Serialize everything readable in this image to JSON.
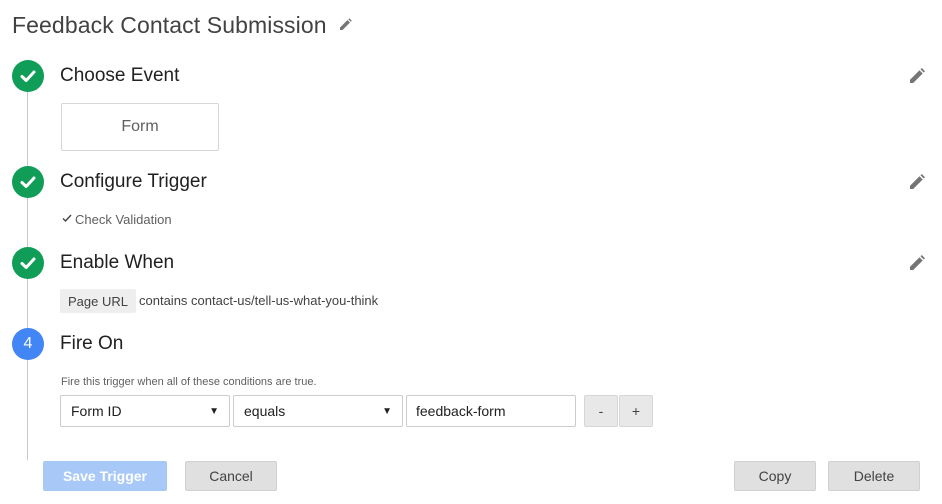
{
  "header": {
    "title": "Feedback Contact Submission",
    "title_edit_icon": "pencil-icon"
  },
  "steps": [
    {
      "title": "Choose Event",
      "status": "done",
      "status_icon": "check-icon",
      "edit_icon": "pencil-icon"
    },
    {
      "title": "Configure Trigger",
      "status": "done",
      "status_icon": "check-icon",
      "edit_icon": "pencil-icon"
    },
    {
      "title": "Enable When",
      "status": "done",
      "status_icon": "check-icon",
      "edit_icon": "pencil-icon"
    },
    {
      "title": "Fire On",
      "status": "current",
      "number": "4"
    }
  ],
  "choose_event": {
    "selected_event": "Form"
  },
  "configure_trigger": {
    "option_check_icon": "check-icon",
    "option_label": "Check Validation"
  },
  "enable_when": {
    "variable": "Page URL",
    "condition": "contains contact-us/tell-us-what-you-think"
  },
  "fire_on": {
    "hint": "Fire this trigger when all of these conditions are true.",
    "variable_select": "Form ID",
    "operator_select": "equals",
    "value_input": "feedback-form",
    "remove_label": "-",
    "add_label": "+"
  },
  "footer": {
    "save_label": "Save Trigger",
    "cancel_label": "Cancel",
    "copy_label": "Copy",
    "delete_label": "Delete"
  },
  "colors": {
    "step_done": "#0f9d58",
    "step_current": "#4285f4",
    "primary_button_disabled": "#a8c8f8",
    "timeline": "#c8c8c8"
  }
}
